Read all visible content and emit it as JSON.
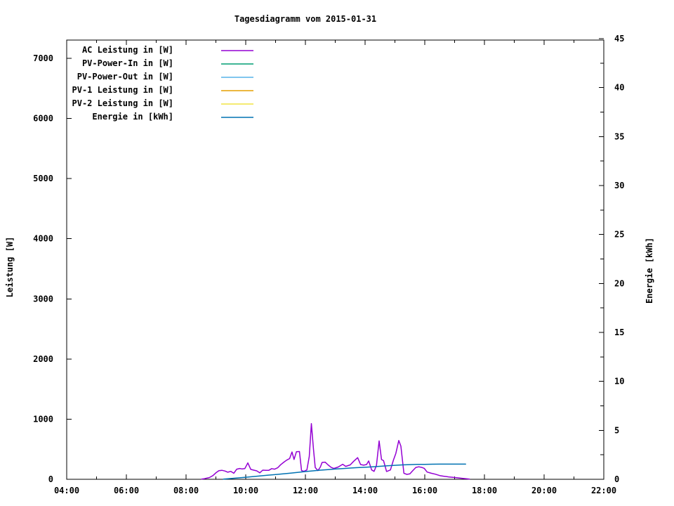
{
  "chart_data": {
    "type": "line",
    "title": "Tagesdiagramm vom 2015-01-31",
    "x_axis": {
      "tick_labels": [
        "04:00",
        "06:00",
        "08:00",
        "10:00",
        "12:00",
        "14:00",
        "16:00",
        "18:00",
        "20:00",
        "22:00"
      ],
      "major_tick_hours": [
        4,
        6,
        8,
        10,
        12,
        14,
        16,
        18,
        20,
        22
      ],
      "minor_tick_step_hours": 1,
      "range_hours": [
        4,
        22
      ]
    },
    "y_left": {
      "label": "Leistung [W]",
      "tick_labels": [
        "0",
        "1000",
        "2000",
        "3000",
        "4000",
        "5000",
        "6000",
        "7000"
      ],
      "tick_values": [
        0,
        1000,
        2000,
        3000,
        4000,
        5000,
        6000,
        7000
      ],
      "range": [
        0,
        7330
      ]
    },
    "y_right": {
      "label": "Energie [kWh]",
      "tick_labels": [
        "0",
        "5",
        "10",
        "15",
        "20",
        "25",
        "30",
        "35",
        "40",
        "45"
      ],
      "tick_values": [
        0,
        5,
        10,
        15,
        20,
        25,
        30,
        35,
        40,
        45
      ],
      "minor_tick_step": 2.5,
      "range": [
        0,
        45
      ]
    },
    "legend_position": "top-left-inside",
    "series": [
      {
        "name": "AC Leistung in [W]",
        "color": "#9400d3",
        "axis": "left",
        "points": [
          [
            8.52,
            2
          ],
          [
            8.6,
            8
          ],
          [
            8.68,
            18
          ],
          [
            8.78,
            28
          ],
          [
            8.9,
            62
          ],
          [
            9.0,
            108
          ],
          [
            9.1,
            142
          ],
          [
            9.2,
            150
          ],
          [
            9.3,
            138
          ],
          [
            9.4,
            118
          ],
          [
            9.5,
            132
          ],
          [
            9.6,
            100
          ],
          [
            9.7,
            168
          ],
          [
            9.8,
            180
          ],
          [
            9.88,
            172
          ],
          [
            9.97,
            178
          ],
          [
            10.07,
            272
          ],
          [
            10.17,
            165
          ],
          [
            10.27,
            152
          ],
          [
            10.37,
            140
          ],
          [
            10.47,
            108
          ],
          [
            10.57,
            152
          ],
          [
            10.67,
            150
          ],
          [
            10.77,
            148
          ],
          [
            10.87,
            178
          ],
          [
            10.97,
            168
          ],
          [
            11.07,
            192
          ],
          [
            11.17,
            242
          ],
          [
            11.27,
            282
          ],
          [
            11.37,
            318
          ],
          [
            11.47,
            345
          ],
          [
            11.55,
            455
          ],
          [
            11.62,
            330
          ],
          [
            11.7,
            458
          ],
          [
            11.8,
            462
          ],
          [
            11.87,
            145
          ],
          [
            11.95,
            132
          ],
          [
            12.05,
            155
          ],
          [
            12.13,
            380
          ],
          [
            12.2,
            925
          ],
          [
            12.27,
            500
          ],
          [
            12.33,
            195
          ],
          [
            12.42,
            145
          ],
          [
            12.5,
            205
          ],
          [
            12.56,
            280
          ],
          [
            12.66,
            285
          ],
          [
            12.76,
            240
          ],
          [
            12.86,
            200
          ],
          [
            12.95,
            180
          ],
          [
            13.1,
            205
          ],
          [
            13.25,
            250
          ],
          [
            13.35,
            215
          ],
          [
            13.5,
            240
          ],
          [
            13.62,
            300
          ],
          [
            13.75,
            360
          ],
          [
            13.85,
            245
          ],
          [
            13.95,
            235
          ],
          [
            14.05,
            245
          ],
          [
            14.12,
            305
          ],
          [
            14.22,
            155
          ],
          [
            14.3,
            132
          ],
          [
            14.38,
            230
          ],
          [
            14.47,
            638
          ],
          [
            14.55,
            330
          ],
          [
            14.62,
            310
          ],
          [
            14.72,
            130
          ],
          [
            14.85,
            155
          ],
          [
            14.95,
            320
          ],
          [
            15.03,
            430
          ],
          [
            15.13,
            645
          ],
          [
            15.2,
            550
          ],
          [
            15.3,
            100
          ],
          [
            15.4,
            82
          ],
          [
            15.5,
            90
          ],
          [
            15.6,
            145
          ],
          [
            15.7,
            198
          ],
          [
            15.8,
            208
          ],
          [
            15.9,
            198
          ],
          [
            15.98,
            182
          ],
          [
            16.08,
            120
          ],
          [
            16.22,
            100
          ],
          [
            16.35,
            85
          ],
          [
            16.5,
            62
          ],
          [
            16.65,
            50
          ],
          [
            16.8,
            40
          ],
          [
            16.95,
            32
          ],
          [
            17.1,
            24
          ],
          [
            17.25,
            16
          ],
          [
            17.4,
            9
          ],
          [
            17.5,
            4
          ]
        ]
      },
      {
        "name": "PV-Power-In in [W]",
        "color": "#009e73",
        "axis": "left",
        "points": []
      },
      {
        "name": "PV-Power-Out in [W]",
        "color": "#56b4e9",
        "axis": "left",
        "points": []
      },
      {
        "name": "PV-1 Leistung in [W]",
        "color": "#e69f00",
        "axis": "left",
        "points": []
      },
      {
        "name": "PV-2 Leistung in [W]",
        "color": "#f0e442",
        "axis": "left",
        "points": []
      },
      {
        "name": "Energie in [kWh]",
        "color": "#0072b2",
        "axis": "right",
        "points": [
          [
            9.25,
            0.02
          ],
          [
            9.5,
            0.08
          ],
          [
            9.75,
            0.14
          ],
          [
            10.0,
            0.21
          ],
          [
            10.25,
            0.28
          ],
          [
            10.5,
            0.35
          ],
          [
            10.75,
            0.42
          ],
          [
            11.0,
            0.49
          ],
          [
            11.25,
            0.56
          ],
          [
            11.5,
            0.63
          ],
          [
            11.75,
            0.71
          ],
          [
            12.0,
            0.79
          ],
          [
            12.25,
            0.86
          ],
          [
            12.5,
            0.93
          ],
          [
            12.75,
            0.99
          ],
          [
            13.0,
            1.05
          ],
          [
            13.25,
            1.1
          ],
          [
            13.5,
            1.15
          ],
          [
            13.75,
            1.19
          ],
          [
            14.0,
            1.23
          ],
          [
            14.25,
            1.28
          ],
          [
            14.5,
            1.33
          ],
          [
            14.75,
            1.38
          ],
          [
            15.0,
            1.43
          ],
          [
            15.25,
            1.47
          ],
          [
            15.5,
            1.5
          ],
          [
            15.75,
            1.52
          ],
          [
            16.0,
            1.53
          ],
          [
            16.25,
            1.54
          ],
          [
            16.5,
            1.55
          ],
          [
            16.75,
            1.55
          ],
          [
            17.0,
            1.55
          ],
          [
            17.2,
            1.55
          ],
          [
            17.37,
            1.55
          ]
        ]
      }
    ]
  },
  "colors": {
    "axis": "#000000",
    "background": "#ffffff"
  }
}
